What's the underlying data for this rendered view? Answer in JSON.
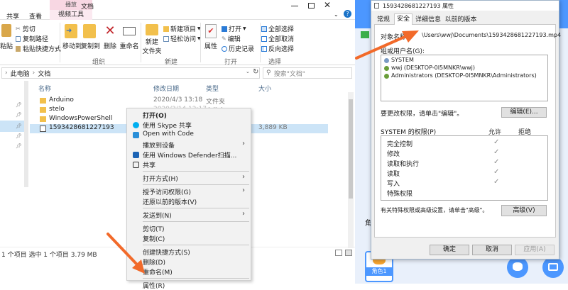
{
  "explorer": {
    "ribbon_tabs": [
      "共享",
      "查看"
    ],
    "tool_tab_group": "播放",
    "tool_tab": "视频工具",
    "window_title": "文档",
    "groups": {
      "organize": "组织",
      "new": "新建",
      "open": "打开",
      "select": "选择"
    },
    "clipboard": {
      "cut": "剪切",
      "copy_path": "复制路径",
      "paste_shortcut": "粘贴快捷方式",
      "paste": "粘贴"
    },
    "organize": {
      "move_to": "移动到",
      "copy_to": "复制到",
      "delete": "删除",
      "rename": "重命名"
    },
    "new": {
      "new_folder_l1": "新建",
      "new_folder_l2": "文件夹",
      "new_item": "新建项目",
      "easy_access": "轻松访问"
    },
    "open": {
      "properties": "属性",
      "open": "打开",
      "edit": "编辑",
      "history": "历史记录"
    },
    "select": {
      "select_all": "全部选择",
      "select_none": "全部取消",
      "invert": "反向选择"
    },
    "address": {
      "crumb1": "此电脑",
      "crumb2": "文档",
      "search_placeholder": "搜索\"文档\""
    },
    "columns": {
      "name": "名称",
      "date": "修改日期",
      "type": "类型",
      "size": "大小"
    },
    "files": [
      {
        "name": "Arduino",
        "date": "2020/4/3 13:18",
        "type": "文件夹",
        "size": ""
      },
      {
        "name": "stelo",
        "date": "2020/3/14 12:17",
        "type": "文件夹",
        "size": ""
      },
      {
        "name": "WindowsPowerShell",
        "date": "",
        "type": "",
        "size": ""
      },
      {
        "name": "1593428681227193",
        "date": "",
        "type": "",
        "size": "3,889 KB"
      }
    ],
    "status": "1 个项目   选中 1 个项目  3.79 MB"
  },
  "context_menu": {
    "items": [
      {
        "label": "打开(O)",
        "bold": true,
        "icon": "",
        "arrow": false,
        "sep_after": false
      },
      {
        "label": "使用 Skype 共享",
        "icon": "skype-icon",
        "arrow": false,
        "sep_after": false
      },
      {
        "label": "Open with Code",
        "icon": "vscode-icon",
        "arrow": false,
        "sep_after": false
      },
      {
        "label": "播放到设备",
        "icon": "",
        "arrow": true,
        "sep_after": false
      },
      {
        "label": "使用 Windows Defender扫描...",
        "icon": "defender-icon",
        "arrow": false,
        "sep_after": false
      },
      {
        "label": "共享",
        "icon": "share-icon",
        "arrow": false,
        "sep_after": true
      },
      {
        "label": "打开方式(H)",
        "icon": "",
        "arrow": true,
        "sep_after": true
      },
      {
        "label": "授予访问权限(G)",
        "icon": "",
        "arrow": true,
        "sep_after": false
      },
      {
        "label": "还原以前的版本(V)",
        "icon": "",
        "arrow": false,
        "sep_after": true
      },
      {
        "label": "发送到(N)",
        "icon": "",
        "arrow": true,
        "sep_after": true
      },
      {
        "label": "剪切(T)",
        "icon": "",
        "arrow": false,
        "sep_after": false
      },
      {
        "label": "复制(C)",
        "icon": "",
        "arrow": false,
        "sep_after": true
      },
      {
        "label": "创建快捷方式(S)",
        "icon": "",
        "arrow": false,
        "sep_after": false
      },
      {
        "label": "删除(D)",
        "icon": "",
        "arrow": false,
        "sep_after": false
      },
      {
        "label": "重命名(M)",
        "icon": "",
        "arrow": false,
        "sep_after": true
      },
      {
        "label": "属性(R)",
        "icon": "",
        "arrow": false,
        "sep_after": false
      }
    ]
  },
  "dialog": {
    "title": "1593428681227193 属性",
    "tabs": [
      "常规",
      "安全",
      "详细信息",
      "以前的版本"
    ],
    "active_tab": 1,
    "object_label": "对象名称:",
    "object_value": "\\Users\\wwj\\Documents\\1593428681227193.mp4",
    "group_label": "组或用户名(G):",
    "users": [
      "SYSTEM",
      "wwj (DESKTOP-0I5MNKR\\wwj)",
      "Administrators (DESKTOP-0I5MNKR\\Administrators)"
    ],
    "change_perm_text": "要更改权限，请单击\"编辑\"。",
    "edit_button": "编辑(E)...",
    "perm_header": "SYSTEM 的权限(P)",
    "allow": "允许",
    "deny": "拒绝",
    "perms": [
      {
        "name": "完全控制",
        "allow": true
      },
      {
        "name": "修改",
        "allow": true
      },
      {
        "name": "读取和执行",
        "allow": true
      },
      {
        "name": "读取",
        "allow": true
      },
      {
        "name": "写入",
        "allow": true
      },
      {
        "name": "特殊权限",
        "allow": false
      }
    ],
    "advanced_text": "有关特殊权限或高级设置，请单击\"高级\"。",
    "advanced_button": "高级(V)",
    "ok": "确定",
    "cancel": "取消",
    "apply": "应用(A)"
  },
  "right_app": {
    "char_label": "角色1",
    "side_text": "角"
  },
  "colors": {
    "arrow": "#f26a2a",
    "accent": "#0078d7",
    "tool_tab": "#f8d7e3"
  }
}
